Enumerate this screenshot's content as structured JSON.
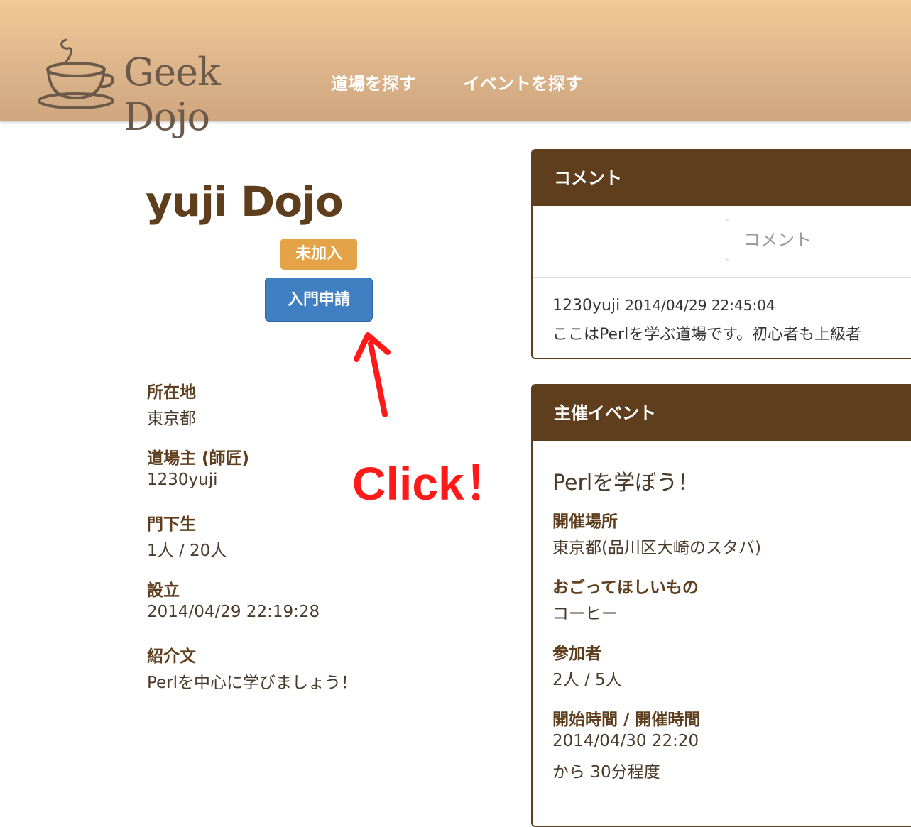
{
  "header": {
    "logo_text": "Geek Dojo",
    "nav": [
      "道場を探す",
      "イベントを探す"
    ]
  },
  "dojo": {
    "title": "yuji Dojo",
    "status_badge": "未加入",
    "join_button": "入門申請",
    "fields": [
      {
        "label": "所在地",
        "value": "東京都"
      },
      {
        "label": "道場主 (師匠)",
        "value": "1230yuji"
      },
      {
        "label": "門下生",
        "value": "1人 / 20人"
      },
      {
        "label": "設立",
        "value": "2014/04/29 22:19:28"
      },
      {
        "label": "紹介文",
        "value": "Perlを中心に学びましょう！"
      }
    ]
  },
  "annotation": {
    "text": "Click！",
    "color": "#ff1a1a"
  },
  "comments": {
    "heading": "コメント",
    "input_placeholder": "コメント",
    "items": [
      {
        "user": "1230yuji",
        "timestamp": "2014/04/29 22:45:04",
        "text": "ここはPerlを学ぶ道場です。初心者も上級者"
      }
    ]
  },
  "events": {
    "heading": "主催イベント",
    "title": "Perlを学ぼう！",
    "fields": [
      {
        "label": "開催場所",
        "value": "東京都(品川区大崎のスタバ)"
      },
      {
        "label": "おごってほしいもの",
        "value": "コーヒー"
      },
      {
        "label": "参加者",
        "value": "2人 / 5人"
      },
      {
        "label": "開始時間 / 開催時間",
        "value": "2014/04/30 22:20",
        "value2": "から 30分程度"
      }
    ]
  },
  "colors": {
    "brand_brown": "#5e3e1c",
    "badge_orange": "#e5a348",
    "button_blue": "#3f7fc2"
  }
}
